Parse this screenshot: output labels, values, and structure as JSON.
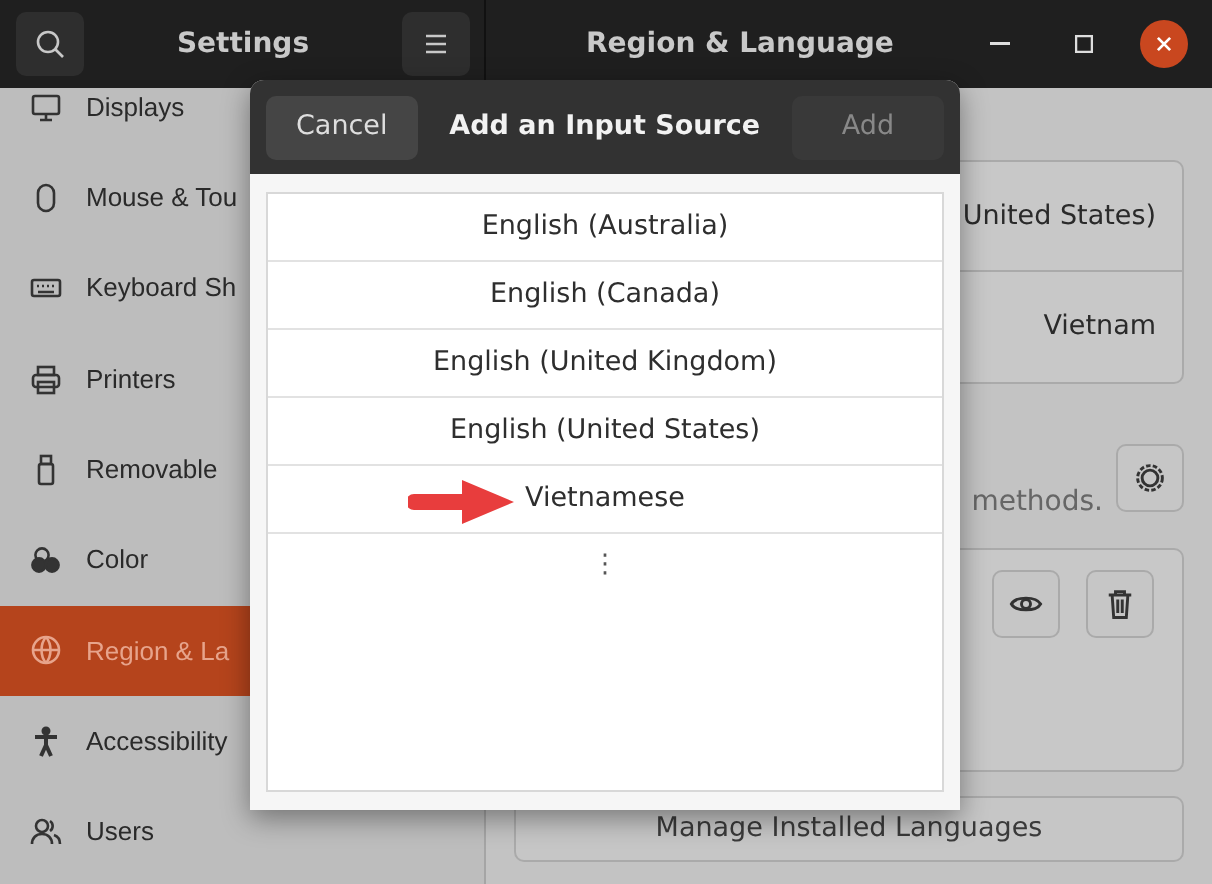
{
  "header": {
    "app_title": "Settings",
    "panel_title": "Region & Language"
  },
  "sidebar": {
    "items": [
      {
        "label": "Displays",
        "selected": false
      },
      {
        "label": "Mouse & Tou",
        "selected": false
      },
      {
        "label": "Keyboard Sh",
        "selected": false
      },
      {
        "label": "Printers",
        "selected": false
      },
      {
        "label": "Removable",
        "selected": false
      },
      {
        "label": "Color",
        "selected": false
      },
      {
        "label": "Region & La",
        "selected": true
      },
      {
        "label": "Accessibility",
        "selected": false
      },
      {
        "label": "Users",
        "selected": false
      }
    ]
  },
  "panel": {
    "rows": [
      "United States)",
      "Vietnam"
    ],
    "hint": "methods.",
    "manage_button": "Manage Installed Languages"
  },
  "dialog": {
    "cancel": "Cancel",
    "title": "Add an Input Source",
    "add": "Add",
    "add_disabled": true,
    "items": [
      {
        "label": "English (Australia)",
        "pointed": false
      },
      {
        "label": "English (Canada)",
        "pointed": false
      },
      {
        "label": "English (United Kingdom)",
        "pointed": false
      },
      {
        "label": "English (United States)",
        "pointed": false
      },
      {
        "label": "Vietnamese",
        "pointed": true
      }
    ],
    "more": "⋮"
  }
}
